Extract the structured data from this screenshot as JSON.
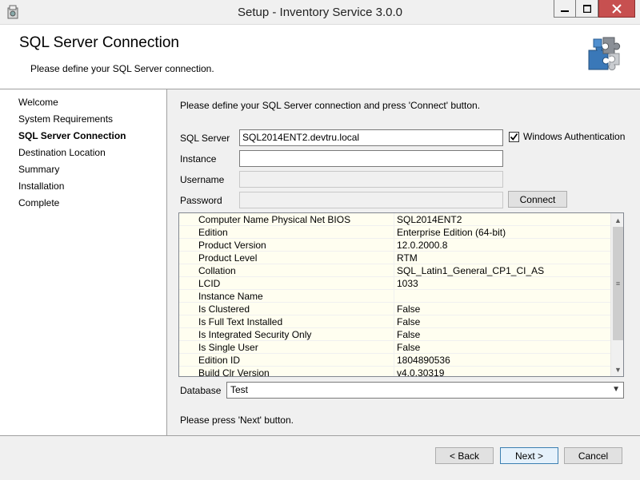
{
  "window": {
    "title": "Setup - Inventory Service 3.0.0",
    "min_icon": "minimize-icon",
    "max_icon": "maximize-icon",
    "close_icon": "close-icon"
  },
  "banner": {
    "title": "SQL Server Connection",
    "subtitle": "Please define your SQL Server connection."
  },
  "steps": [
    {
      "label": "Welcome",
      "active": false
    },
    {
      "label": "System Requirements",
      "active": false
    },
    {
      "label": "SQL Server Connection",
      "active": true
    },
    {
      "label": "Destination Location",
      "active": false
    },
    {
      "label": "Summary",
      "active": false
    },
    {
      "label": "Installation",
      "active": false
    },
    {
      "label": "Complete",
      "active": false
    }
  ],
  "form": {
    "intro": "Please define your SQL Server connection and press 'Connect' button.",
    "sql_server_label": "SQL Server",
    "sql_server_value": "SQL2014ENT2.devtru.local",
    "windows_auth_label": "Windows Authentication",
    "windows_auth_checked": true,
    "instance_label": "Instance",
    "instance_value": "",
    "username_label": "Username",
    "username_value": "",
    "password_label": "Password",
    "password_value": "",
    "connect_label": "Connect"
  },
  "properties": [
    {
      "name": "Computer Name Physical Net BIOS",
      "value": "SQL2014ENT2"
    },
    {
      "name": "Edition",
      "value": "Enterprise Edition (64-bit)"
    },
    {
      "name": "Product Version",
      "value": "12.0.2000.8"
    },
    {
      "name": "Product Level",
      "value": "RTM"
    },
    {
      "name": "Collation",
      "value": "SQL_Latin1_General_CP1_CI_AS"
    },
    {
      "name": "LCID",
      "value": "1033"
    },
    {
      "name": "Instance Name",
      "value": ""
    },
    {
      "name": "Is Clustered",
      "value": "False"
    },
    {
      "name": "Is Full Text Installed",
      "value": "False"
    },
    {
      "name": "Is Integrated Security Only",
      "value": "False"
    },
    {
      "name": "Is Single User",
      "value": "False"
    },
    {
      "name": "Edition ID",
      "value": "1804890536"
    },
    {
      "name": "Build Clr Version",
      "value": "v4.0.30319"
    }
  ],
  "database": {
    "label": "Database",
    "selected": "Test"
  },
  "outro": "Please press 'Next' button.",
  "footer": {
    "back_label": "< Back",
    "next_label": "Next >",
    "cancel_label": "Cancel"
  }
}
